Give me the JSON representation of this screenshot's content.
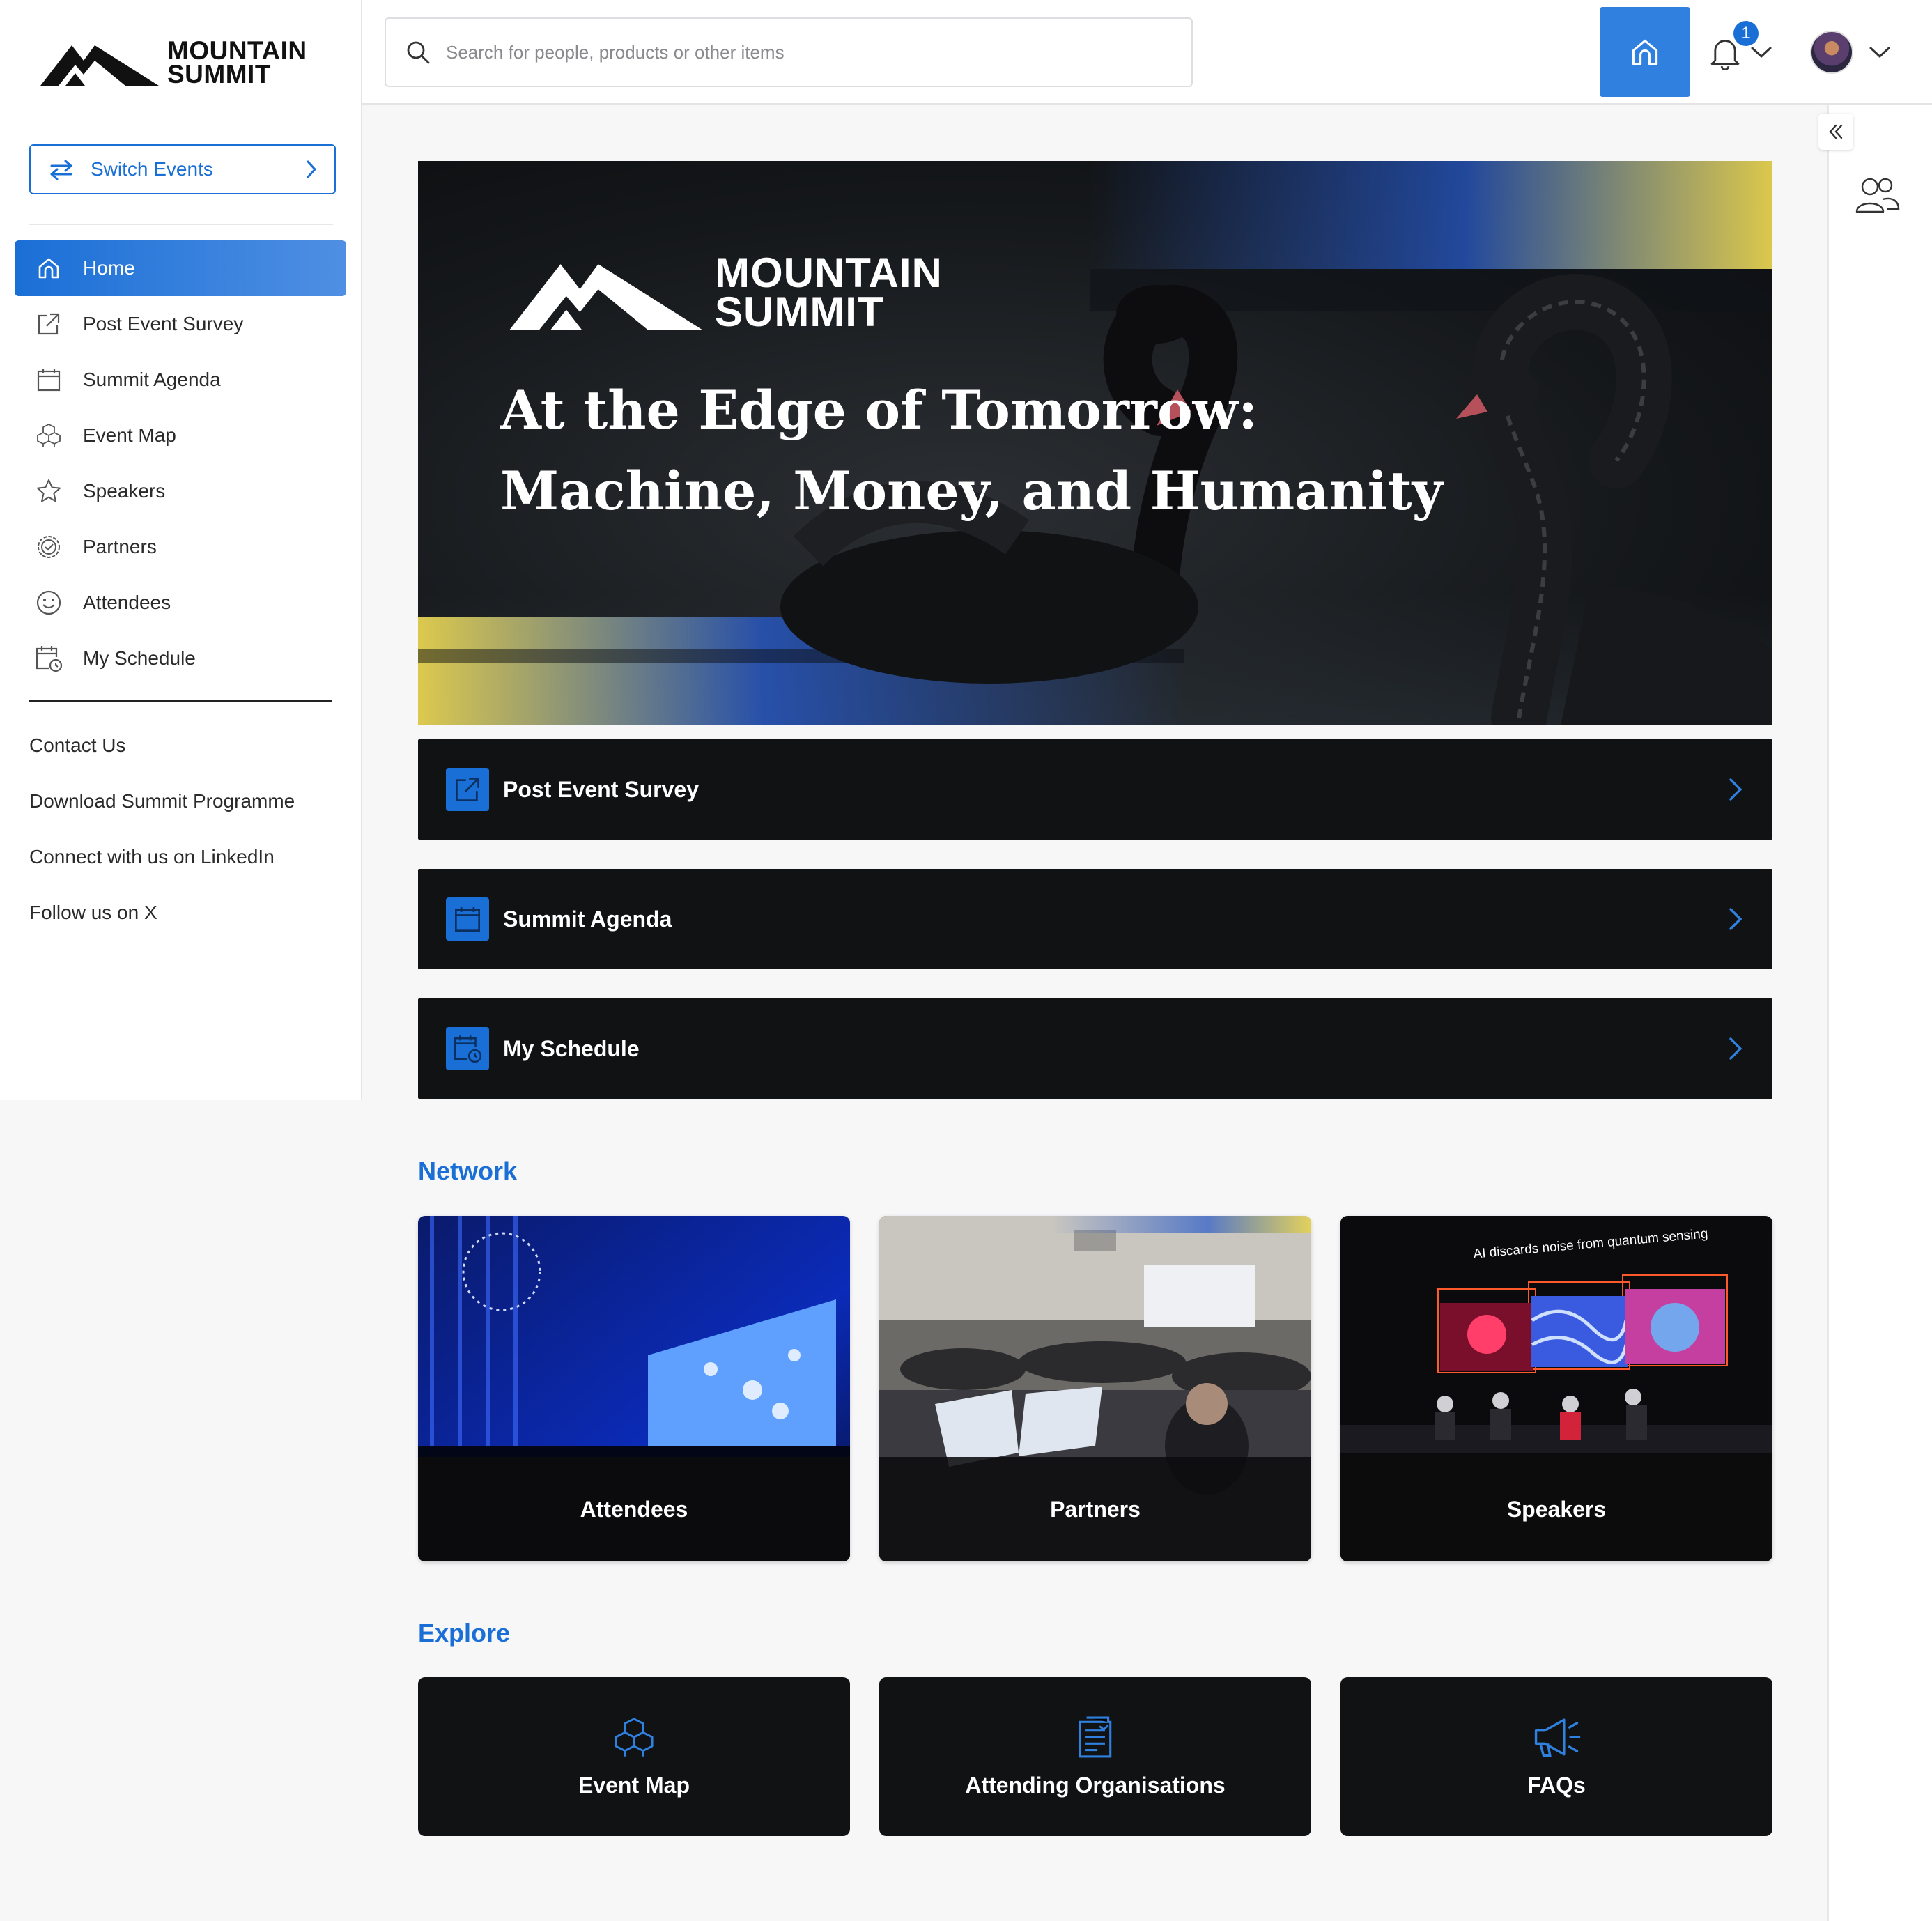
{
  "brand": {
    "name_line1": "MOUNTAIN",
    "name_line2": "SUMMIT"
  },
  "sidebar": {
    "switch_events": "Switch Events",
    "nav": [
      {
        "label": "Home",
        "icon": "home-icon",
        "active": true
      },
      {
        "label": "Post Event Survey",
        "icon": "external-link-icon"
      },
      {
        "label": "Summit Agenda",
        "icon": "calendar-icon"
      },
      {
        "label": "Event Map",
        "icon": "cubes-icon"
      },
      {
        "label": "Speakers",
        "icon": "star-icon"
      },
      {
        "label": "Partners",
        "icon": "badge-icon"
      },
      {
        "label": "Attendees",
        "icon": "smiley-icon"
      },
      {
        "label": "My Schedule",
        "icon": "calendar-clock-icon"
      }
    ],
    "links": [
      "Contact Us",
      "Download Summit Programme",
      "Connect with us on LinkedIn",
      "Follow us on X"
    ]
  },
  "header": {
    "search_placeholder": "Search for people, products or other items",
    "notifications_count": "1"
  },
  "hero": {
    "title_line1": "At the Edge of Tomorrow:",
    "title_line2": "Machine, Money, and Humanity"
  },
  "actions": [
    {
      "label": "Post Event Survey",
      "icon": "external-link-icon"
    },
    {
      "label": "Summit Agenda",
      "icon": "calendar-icon"
    },
    {
      "label": "My Schedule",
      "icon": "calendar-clock-icon"
    }
  ],
  "network": {
    "title": "Network",
    "cards": [
      "Attendees",
      "Partners",
      "Speakers"
    ],
    "speakers_screen_text": "AI discards noise from quantum sensing"
  },
  "explore": {
    "title": "Explore",
    "tiles": [
      {
        "label": "Event Map",
        "icon": "cubes-icon"
      },
      {
        "label": "Attending Organisations",
        "icon": "document-icon"
      },
      {
        "label": "FAQs",
        "icon": "megaphone-icon"
      }
    ]
  },
  "colors": {
    "accent": "#1a6fd6",
    "dark": "#111214",
    "hero_gold": "#e6d250"
  }
}
